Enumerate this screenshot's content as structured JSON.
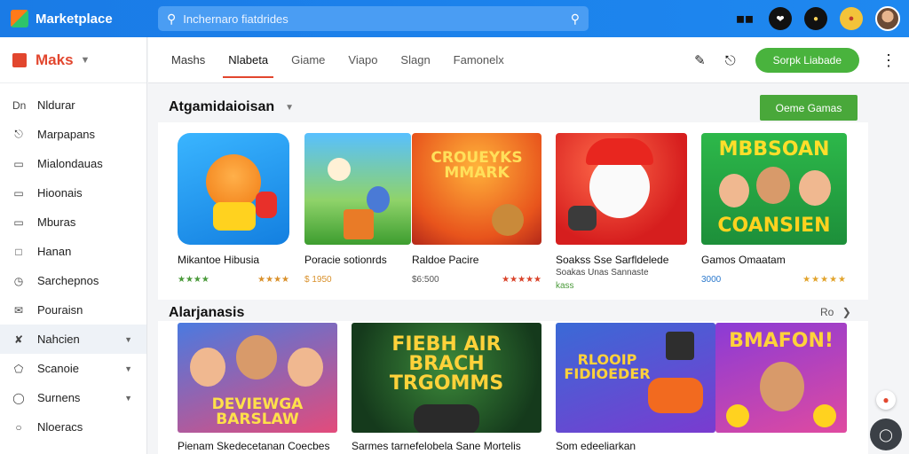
{
  "header": {
    "brand": "Marketplace",
    "search_placeholder": "Inchernaro fiatdrides",
    "icons": [
      "gamepad-icon",
      "heart-icon",
      "ninja-icon",
      "controller-icon",
      "avatar"
    ]
  },
  "sidebar": {
    "title": "Maks",
    "items": [
      {
        "label": "Nldurar",
        "icon": "Dn"
      },
      {
        "label": "Marpapans",
        "icon": "bell-icon"
      },
      {
        "label": "Mialondauas",
        "icon": "box-icon"
      },
      {
        "label": "Hioonais",
        "icon": "box-icon"
      },
      {
        "label": "Mburas",
        "icon": "box-icon"
      },
      {
        "label": "Hanan",
        "icon": "square-icon"
      },
      {
        "label": "Sarchepnos",
        "icon": "clock-icon"
      },
      {
        "label": "Pouraisn",
        "icon": "mail-icon"
      },
      {
        "label": "Nahcien",
        "icon": "tools-icon",
        "caret": true,
        "active": true
      },
      {
        "label": "Scanoie",
        "icon": "shield-icon",
        "caret": true
      },
      {
        "label": "Surnens",
        "icon": "chat-icon",
        "caret": true
      },
      {
        "label": "Nloeracs",
        "icon": "circle-icon"
      }
    ]
  },
  "subnav": {
    "tabs": [
      "Mashs",
      "Nlabeta",
      "Giame",
      "Viapo",
      "Slagn",
      "Famonelx"
    ],
    "active_tab": 1,
    "button": "Sorpk Liabade"
  },
  "section1": {
    "title": "Atgamidaioisan",
    "cta": "Oeme Gamas",
    "cards": [
      {
        "title": "Mikantoe Hibusia",
        "meta_left": "★★★★",
        "meta_right": "★★★★"
      },
      {
        "title": "Poracie sotionrds",
        "meta_left": "$ 1950",
        "meta_right": ""
      },
      {
        "title": "Raldoe Pacire",
        "meta_left": "$6:500",
        "meta_right": "★★★★★"
      },
      {
        "title": "Soakss Sse Sarfldelede",
        "subtitle": "Soakas Unas Sannaste",
        "meta_left": "kass",
        "meta_right": ""
      },
      {
        "title": "Gamos Omaatam",
        "meta_left": "3000",
        "meta_right": "★★★★★"
      }
    ]
  },
  "section2": {
    "title": "Alarjanasis",
    "more": "Ro",
    "cards": [
      {
        "title": "Pienam Skedecetanan Coecbes",
        "art": "DEVIEWGA BARSLAW"
      },
      {
        "title": "Sarmes tarnefelobela Sane Mortelis",
        "art": "FIEBH AIR BRACH TRGOMMS"
      },
      {
        "title": "Som edeeliarkan",
        "art": "RLOOIP FIDIOEDER"
      },
      {
        "title": "",
        "art": "BMAFON!"
      }
    ]
  },
  "artwork": {
    "card3": "CROUEYKS MMARK",
    "card5_top": "MBBSOAN",
    "card5_bottom": "COANSIEN"
  }
}
